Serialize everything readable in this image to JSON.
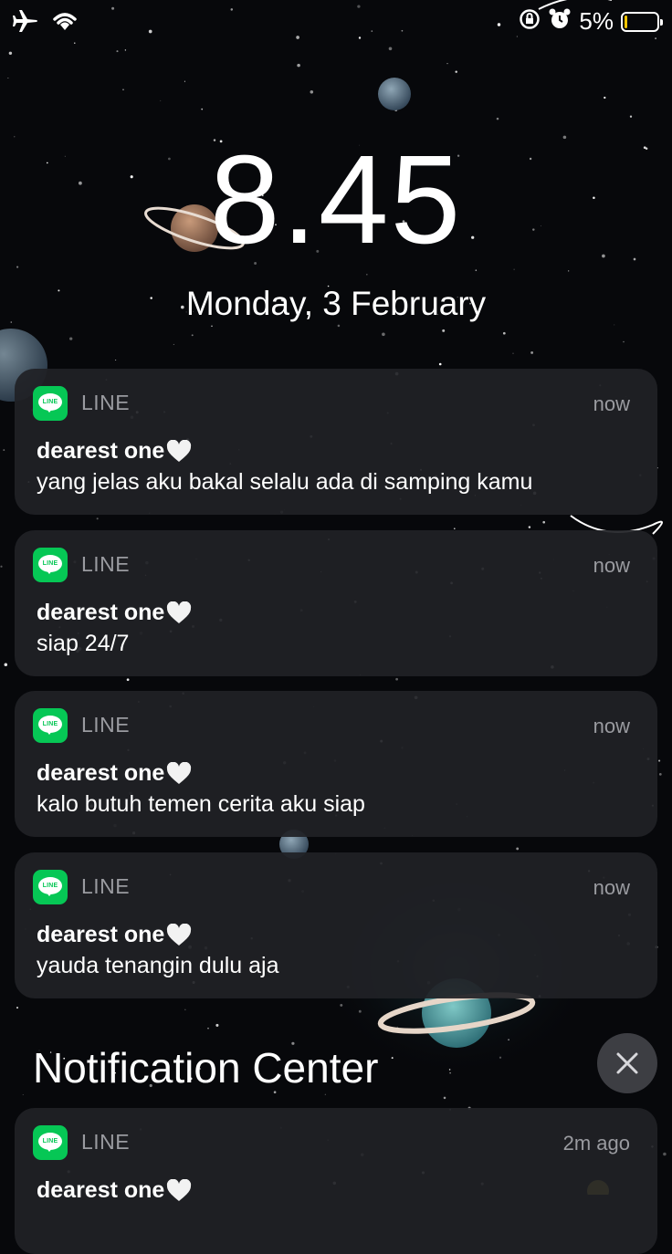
{
  "status_bar": {
    "battery_percent": "5%",
    "battery_level": 0.05,
    "icons": [
      "airplane-icon",
      "wifi-icon",
      "orientation-lock-icon",
      "alarm-icon",
      "battery-icon"
    ]
  },
  "lock_screen": {
    "time": "8.45",
    "date": "Monday, 3 February"
  },
  "notifications": [
    {
      "app": "LINE",
      "time": "now",
      "title": "dearest one",
      "message": "yang jelas aku bakal selalu ada di samping kamu"
    },
    {
      "app": "LINE",
      "time": "now",
      "title": "dearest one",
      "message": "siap 24/7"
    },
    {
      "app": "LINE",
      "time": "now",
      "title": "dearest one",
      "message": "kalo butuh temen cerita aku siap"
    },
    {
      "app": "LINE",
      "time": "now",
      "title": "dearest one",
      "message": "yauda tenangin dulu aja"
    }
  ],
  "notification_center": {
    "title": "Notification Center",
    "items": [
      {
        "app": "LINE",
        "time": "2m ago",
        "title": "dearest one"
      }
    ]
  },
  "app_icon_text": "LINE",
  "colors": {
    "line_green": "#06c755",
    "card_bg": "#202126",
    "secondary_text": "#9a9ba0"
  }
}
